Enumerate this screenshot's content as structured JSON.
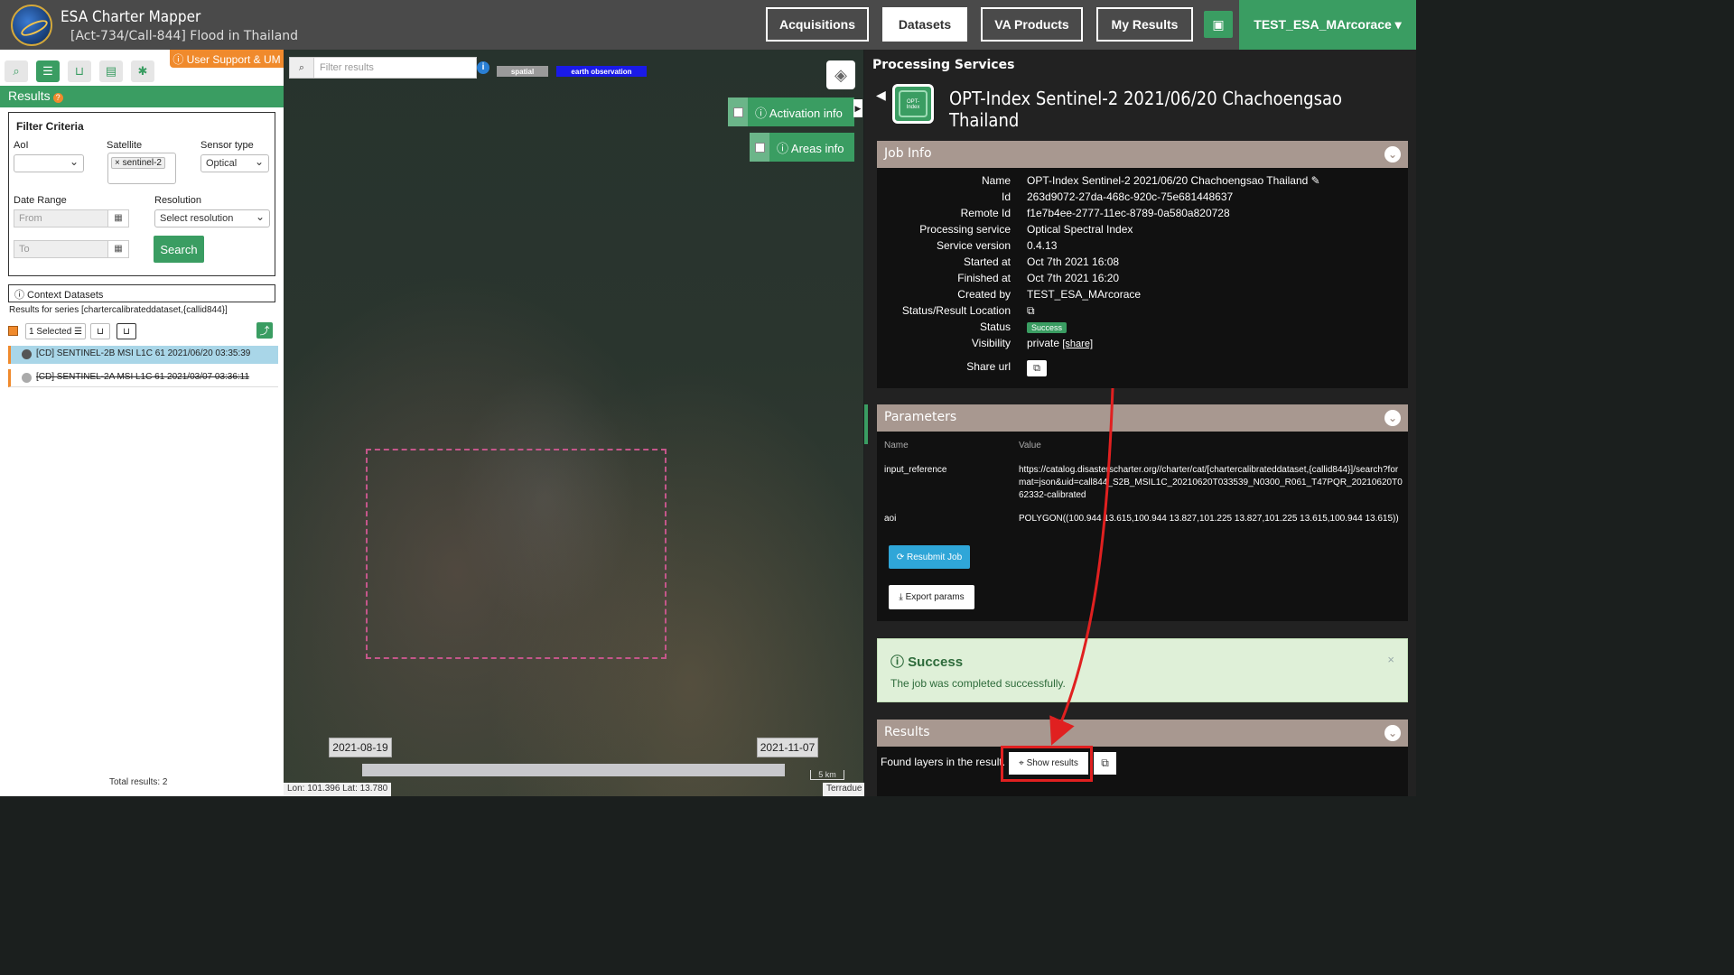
{
  "header": {
    "app_title": "ESA Charter Mapper",
    "activation": "[Act-734/Call-844] Flood in Thailand",
    "nav": [
      "Acquisitions",
      "Datasets",
      "VA Products",
      "My Results"
    ],
    "user": "TEST_ESA_MArcorace ▾"
  },
  "left": {
    "support": "ⓘ User Support & UM",
    "results_title": "Results",
    "filter_title": "Filter Criteria",
    "aoi_label": "AoI",
    "satellite_label": "Satellite",
    "satellite_tag": "× sentinel-2",
    "sensor_label": "Sensor type",
    "sensor_value": "Optical",
    "date_label": "Date Range",
    "from_placeholder": "From",
    "to_placeholder": "To",
    "resolution_label": "Resolution",
    "resolution_value": "Select resolution",
    "search_label": "Search",
    "context_label": "ⓘ Context Datasets",
    "series_text": "Results for series [chartercalibrateddataset,{callid844}]",
    "selected_label": "1 Selected ☰",
    "datasets": [
      "[CD] SENTINEL-2B MSI L1C 61 2021/06/20 03:35:39",
      "[CD] SENTINEL-2A MSI L1C 61 2021/03/07 03:36:11"
    ],
    "total": "Total results: 2"
  },
  "map": {
    "filter_placeholder": "Filter results",
    "tags": [
      "spatial",
      "earth observation"
    ],
    "activation_info": "ⓘ Activation info",
    "areas_info": "ⓘ Areas info",
    "date_start": "2021-08-19",
    "date_end": "2021-11-07",
    "scale": "5 km",
    "coords": "Lon: 101.396 Lat: 13.780",
    "attribution": "Terradue"
  },
  "right": {
    "section_title": "Processing Services",
    "job_title": "OPT-Index Sentinel-2 2021/06/20 Chachoengsao Thailand",
    "job_info_head": "Job Info",
    "job_info": [
      {
        "k": "Name",
        "v": "OPT-Index Sentinel-2 2021/06/20 Chachoengsao Thailand ✎"
      },
      {
        "k": "Id",
        "v": "263d9072-27da-468c-920c-75e681448637"
      },
      {
        "k": "Remote Id",
        "v": "f1e7b4ee-2777-11ec-8789-0a580a820728"
      },
      {
        "k": "Processing service",
        "v": "Optical Spectral Index"
      },
      {
        "k": "Service version",
        "v": "0.4.13"
      },
      {
        "k": "Started at",
        "v": "Oct 7th 2021 16:08"
      },
      {
        "k": "Finished at",
        "v": "Oct 7th 2021 16:20"
      },
      {
        "k": "Created by",
        "v": "TEST_ESA_MArcorace"
      },
      {
        "k": "Status/Result Location",
        "v": "⧉"
      }
    ],
    "status_key": "Status",
    "status_val": "Success",
    "visibility_key": "Visibility",
    "visibility_val": "private",
    "share_link": "[share]",
    "shareurl_key": "Share url",
    "params_head": "Parameters",
    "param_name_col": "Name",
    "param_value_col": "Value",
    "params": [
      {
        "k": "input_reference",
        "v": "https://catalog.disasterscharter.org//charter/cat/[chartercalibrateddataset,{callid844}]/search?format=json&uid=call844_S2B_MSIL1C_20210620T033539_N0300_R061_T47PQR_20210620T062332-calibrated"
      },
      {
        "k": "aoi",
        "v": "POLYGON((100.944 13.615,100.944 13.827,101.225 13.827,101.225 13.615,100.944 13.615))"
      }
    ],
    "resubmit": "⟳ Resubmit Job",
    "export": "⤓ Export params",
    "success_title": "ⓘ Success",
    "success_msg": "The job was completed successfully.",
    "results_head": "Results",
    "found_layers": "Found layers in the result.",
    "show_results": "⌖ Show results"
  },
  "colors": {
    "accent": "#3a9d62",
    "section": "#a89890",
    "highlight": "#e02020"
  }
}
